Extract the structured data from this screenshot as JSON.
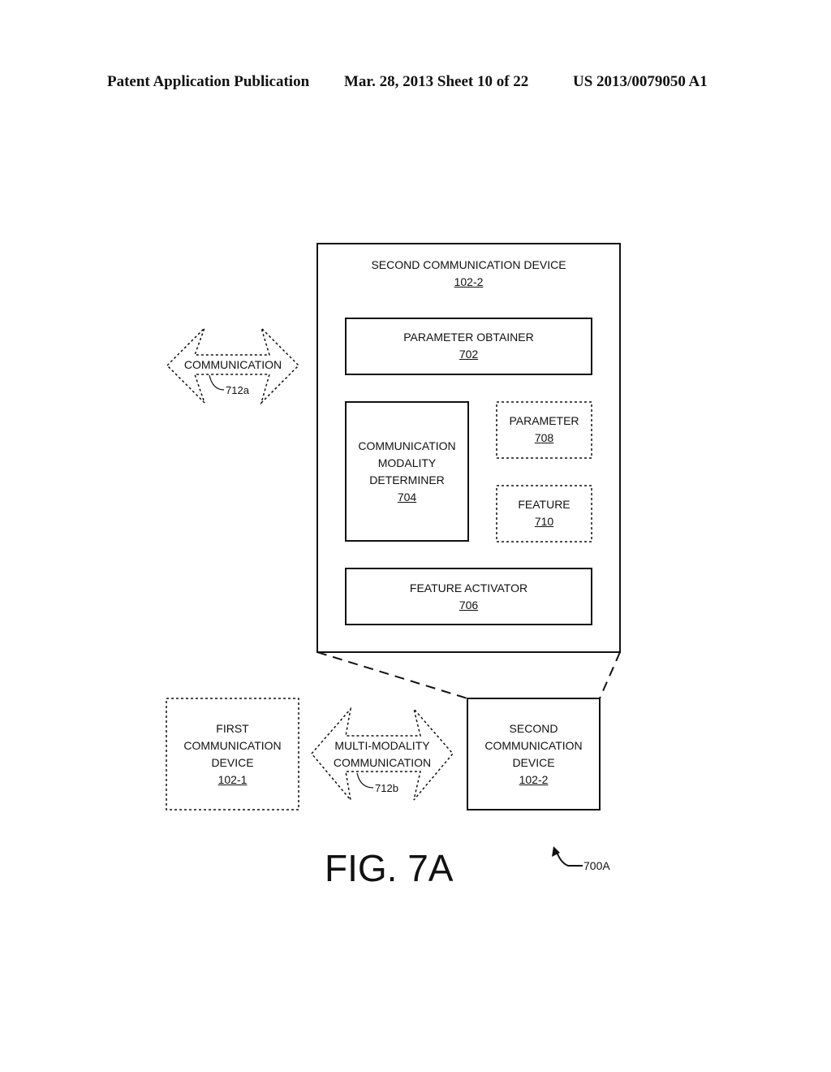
{
  "header": {
    "left": "Patent Application Publication",
    "center": "Mar. 28, 2013  Sheet 10 of 22",
    "right": "US 2013/0079050 A1"
  },
  "device_detail": {
    "title": "SECOND COMMUNICATION DEVICE",
    "ref": "102-2",
    "parameter_obtainer": {
      "label": "PARAMETER OBTAINER",
      "ref": "702"
    },
    "modality_determiner": {
      "line1": "COMMUNICATION",
      "line2": "MODALITY",
      "line3": "DETERMINER",
      "ref": "704"
    },
    "parameter": {
      "label": "PARAMETER",
      "ref": "708"
    },
    "feature": {
      "label": "FEATURE",
      "ref": "710"
    },
    "feature_activator": {
      "label": "FEATURE ACTIVATOR",
      "ref": "706"
    }
  },
  "communication_arrow": {
    "label": "COMMUNICATION",
    "ref": "712a"
  },
  "first_device": {
    "line1": "FIRST",
    "line2": "COMMUNICATION",
    "line3": "DEVICE",
    "ref": "102-1"
  },
  "multi_arrow": {
    "line1": "MULTI-MODALITY",
    "line2": "COMMUNICATION",
    "ref": "712b"
  },
  "second_device": {
    "line1": "SECOND",
    "line2": "COMMUNICATION",
    "line3": "DEVICE",
    "ref": "102-2"
  },
  "figure": {
    "label": "FIG. 7A",
    "ref": "700A"
  }
}
